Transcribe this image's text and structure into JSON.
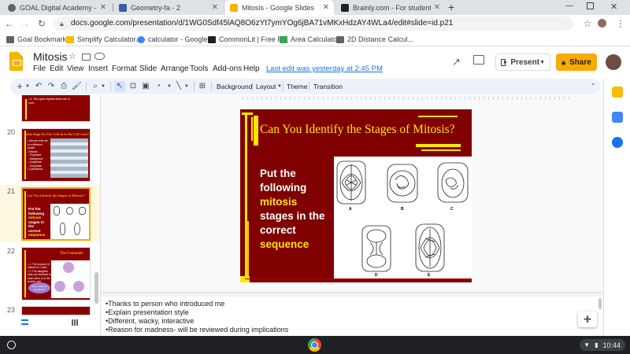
{
  "browser": {
    "tabs": [
      {
        "title": "GOAL Digital Academy - Attendan",
        "color": "#5f6368",
        "active": false
      },
      {
        "title": "Geometry-fa - 2",
        "color": "#3c5ba9",
        "active": false
      },
      {
        "title": "Mitosis - Google Slides",
        "color": "#f4b400",
        "active": true
      },
      {
        "title": "Brainly.com - For students. By stu",
        "color": "#202124",
        "active": false
      }
    ],
    "new_tab": "+",
    "url": "docs.google.com/presentation/d/1WG0Sdf45lAQ8O6zYt7ymYOg6jBA71vMKxHdzAY4WLa4/edit#slide=id.p21",
    "bookmarks": [
      {
        "label": "Goal Bookmarks",
        "color": "#5f6368"
      },
      {
        "label": "Simplify Calculator...",
        "color": "#fbbc04"
      },
      {
        "label": "calculator - Google...",
        "color": "#4285f4"
      },
      {
        "label": "CommonLit | Free R...",
        "color": "#202124"
      },
      {
        "label": "Area Calculator",
        "color": "#34a853"
      },
      {
        "label": "2D Distance Calcul...",
        "color": "#5f6368"
      }
    ]
  },
  "doc": {
    "title": "Mitosis",
    "menu": [
      "File",
      "Edit",
      "View",
      "Insert",
      "Format",
      "Slide",
      "Arrange",
      "Tools",
      "Add-ons",
      "Help"
    ],
    "last_edit": "Last edit was yesterday at 2:45 PM",
    "present_label": "Present",
    "share_label": "Share"
  },
  "toolbar": {
    "background_label": "Background",
    "layout_label": "Layout",
    "theme_label": "Theme",
    "transition_label": "Transition"
  },
  "filmstrip": {
    "slides": [
      {
        "num": "",
        "title": "",
        "bullets": [
          "• 3. The cycle repeats itself over &",
          "  over..."
        ]
      },
      {
        "num": "20",
        "title": "What Stage Are The Cells In In The Cell Cycle?",
        "bullets": [
          "• Almost cells are in a different phase",
          "• Mitosis",
          "  – Prophase",
          "  – Metaphase",
          "  – Anaphase",
          "  – Telophase",
          "• Cytokinesis"
        ]
      },
      {
        "num": "21",
        "title": "Can You Identify the Stages of Mitosis?",
        "bullets": [
          "Put the",
          "following",
          "mitosis",
          "stages in the",
          "correct",
          "sequence"
        ]
      },
      {
        "num": "22",
        "title": "The Guarantee",
        "bullets": [
          "• 1. The product of mitosis is 2 cells",
          "• 2. The daughter cells are identical to each other & to the mother cell"
        ],
        "question": "Why is Mitosis Important?"
      },
      {
        "num": "23",
        "title": "",
        "bullets": []
      }
    ]
  },
  "slide": {
    "title": "Can You Identify the Stages of Mitosis?",
    "body_lines": [
      "Put the",
      "following"
    ],
    "body_highlight": "mitosis",
    "body_lines2": [
      "stages in the",
      "correct"
    ],
    "body_highlight2": "sequence",
    "diagram_labels": [
      "A",
      "B",
      "C",
      "D",
      "E"
    ]
  },
  "notes": {
    "lines": [
      "•Thanks to person who introduced me",
      "•Explain presentation style",
      "•Different, wacky, interactive",
      "•Reason for madness- will be reviewed during implications"
    ]
  },
  "shelf": {
    "time": "10:44"
  },
  "colors": {
    "slide_bg": "#800000",
    "slide_accent": "#ffe600",
    "share": "#f9ab00",
    "link": "#1a73e8"
  }
}
